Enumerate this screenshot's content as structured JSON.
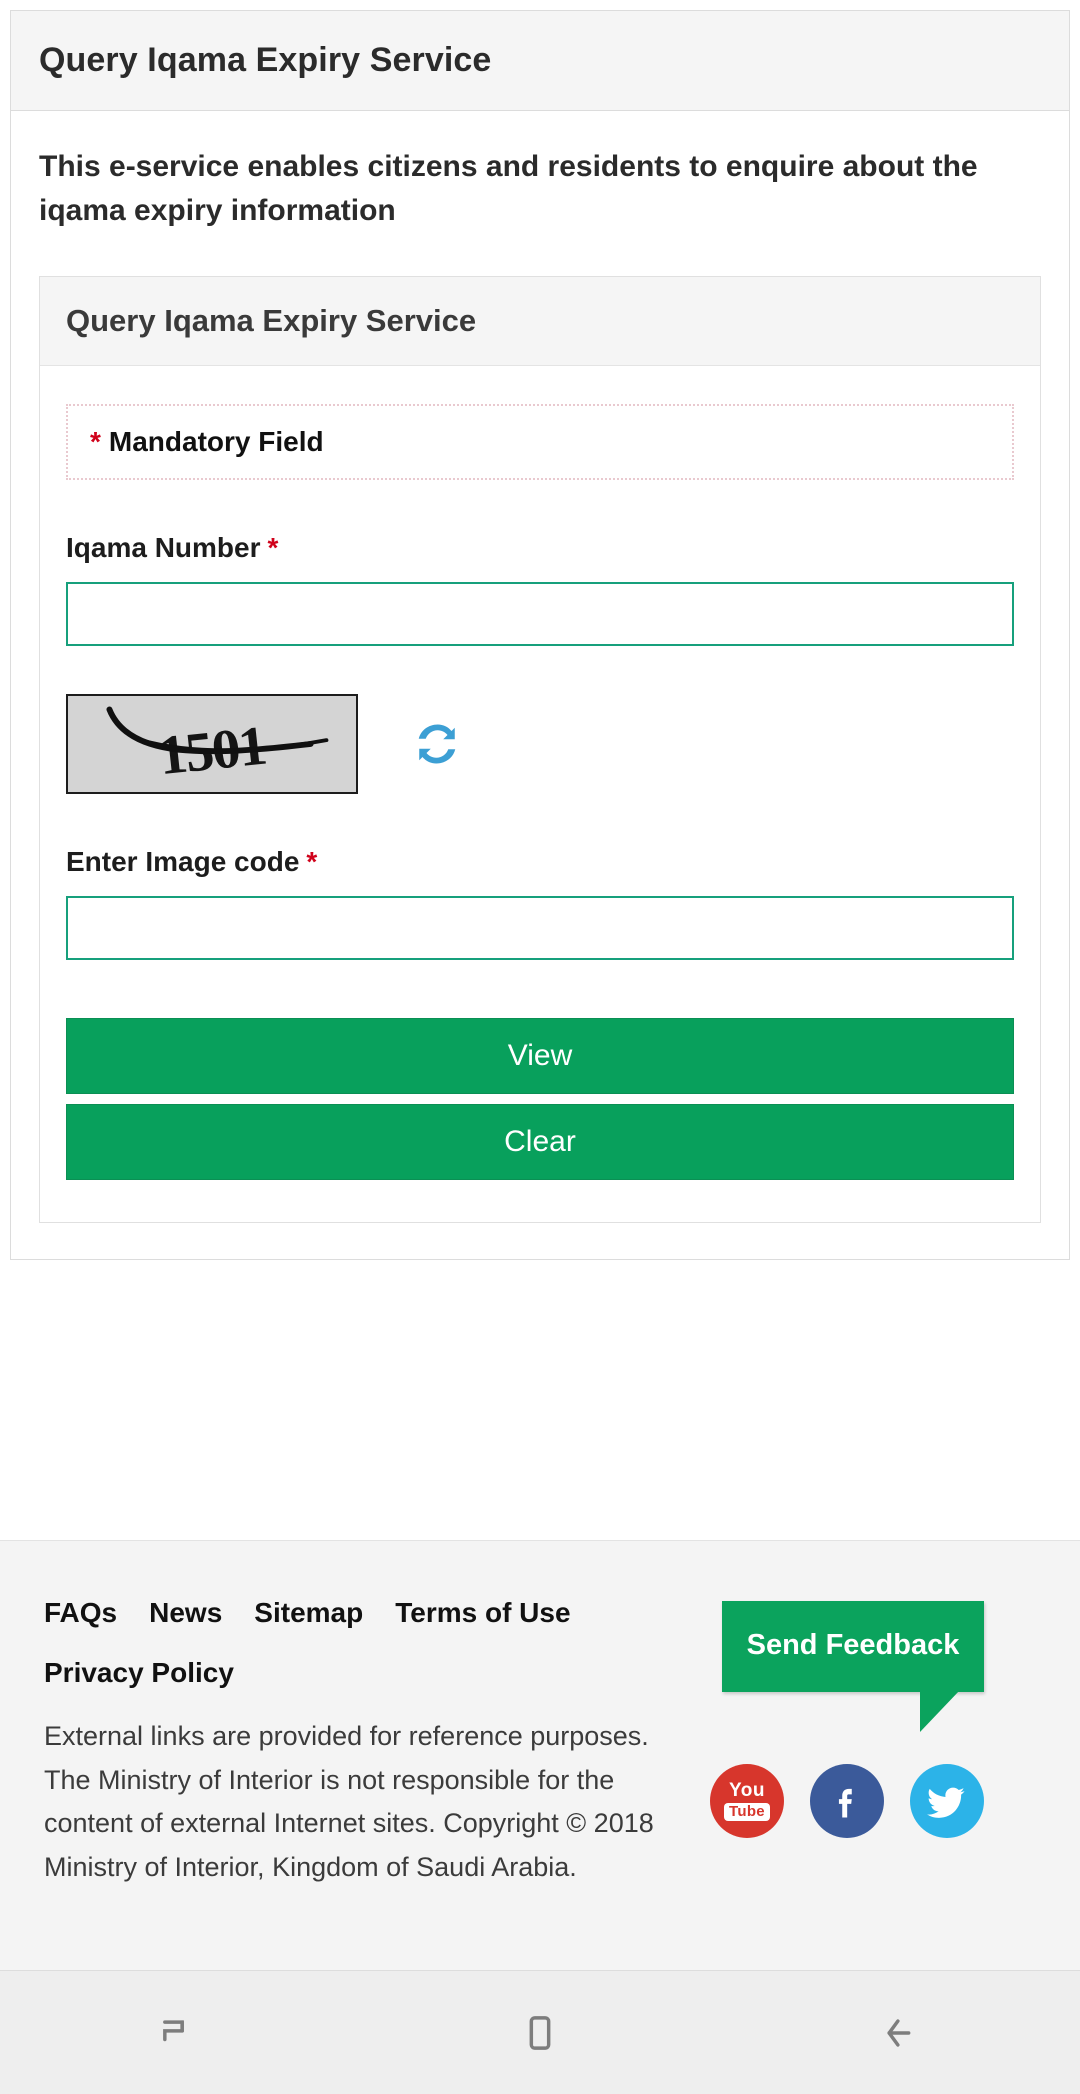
{
  "page": {
    "header_title": "Query Iqama Expiry Service",
    "description": "This e-service enables citizens and residents to enquire about the iqama expiry information"
  },
  "service_panel": {
    "title": "Query Iqama Expiry Service",
    "mandatory_note": "Mandatory Field",
    "required_marker": "*",
    "fields": [
      {
        "label": "Iqama Number",
        "required_marker": "*",
        "value": "",
        "placeholder": ""
      },
      {
        "label": "Enter Image code",
        "required_marker": "*",
        "value": "",
        "placeholder": ""
      }
    ],
    "captcha": {
      "code_text": "1501",
      "refresh_icon": "refresh-icon",
      "refresh_color": "#3c9fd4"
    },
    "buttons": [
      {
        "label": "View",
        "name": "view-button"
      },
      {
        "label": "Clear",
        "name": "clear-button"
      }
    ],
    "button_color": "#08a05c"
  },
  "footer": {
    "links_row1": [
      "FAQs",
      "News",
      "Sitemap",
      "Terms of Use"
    ],
    "links_row2": [
      "Privacy Policy"
    ],
    "disclaimer": "External links are provided for reference purposes. The Ministry of Interior is not responsible for the content of external Internet sites. Copyright © 2018 Ministry of Interior, Kingdom of Saudi Arabia.",
    "feedback_label": "Send Feedback",
    "feedback_color": "#0ba35d",
    "social": [
      {
        "name": "youtube-icon",
        "label_top": "You",
        "label_bottom": "Tube",
        "color": "#d7362c"
      },
      {
        "name": "facebook-icon",
        "label": "f",
        "color": "#3b5a9a"
      },
      {
        "name": "twitter-icon",
        "label": "",
        "color": "#2cb3e8"
      }
    ]
  },
  "navbar": {
    "buttons": [
      {
        "name": "recents-button",
        "icon": "recents-icon"
      },
      {
        "name": "home-button",
        "icon": "home-icon"
      },
      {
        "name": "back-button",
        "icon": "back-arrow-icon"
      }
    ]
  }
}
